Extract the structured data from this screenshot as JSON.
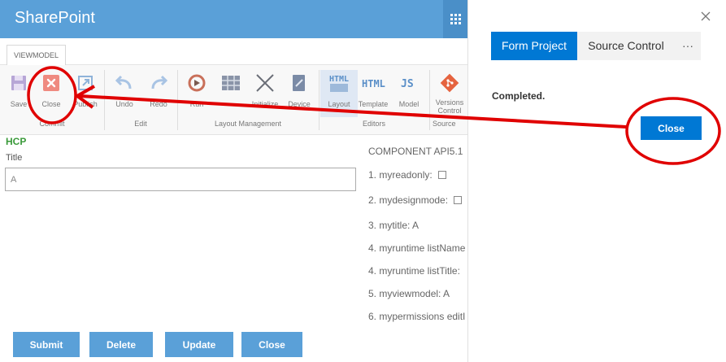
{
  "app": {
    "title": "SharePoint"
  },
  "tabs": {
    "viewmodel": "VIEWMODEL"
  },
  "ribbon": {
    "commit": {
      "label": "Commit",
      "save": "Save",
      "close": "Close",
      "publish": "Publish"
    },
    "edit": {
      "label": "Edit",
      "undo": "Undo",
      "redo": "Redo"
    },
    "layout": {
      "label": "Layout Management",
      "run": "Run",
      "initialize": "Initialize",
      "device": "Device"
    },
    "editors": {
      "label": "Editors",
      "layout": "Layout",
      "template": "Template",
      "model": "Model"
    },
    "source": {
      "label": "Source",
      "versions": "Versions Control"
    }
  },
  "form": {
    "section": "HCP",
    "title_label": "Title",
    "title_value": "A",
    "buttons": {
      "submit": "Submit",
      "delete": "Delete",
      "update": "Update",
      "close": "Close"
    }
  },
  "component": {
    "heading": "COMPONENT API5.1",
    "lines": [
      "1. myreadonly:",
      "2. mydesignmode:",
      "3. mytitle: A",
      "4. myruntime listName",
      "4. myruntime listTitle:",
      "5. myviewmodel: A",
      "6. mypermissions editI"
    ],
    "checkboxes": {
      "myreadonly": false,
      "mydesignmode": false
    }
  },
  "panel": {
    "tabs": {
      "form_project": "Form Project",
      "source_control": "Source Control",
      "more": "···"
    },
    "status": "Completed.",
    "close_button": "Close"
  },
  "colors": {
    "topbar": "#5aa0d8",
    "panel_accent": "#0078d4",
    "annotation": "#e00000",
    "hcp": "#3a9a3a"
  }
}
